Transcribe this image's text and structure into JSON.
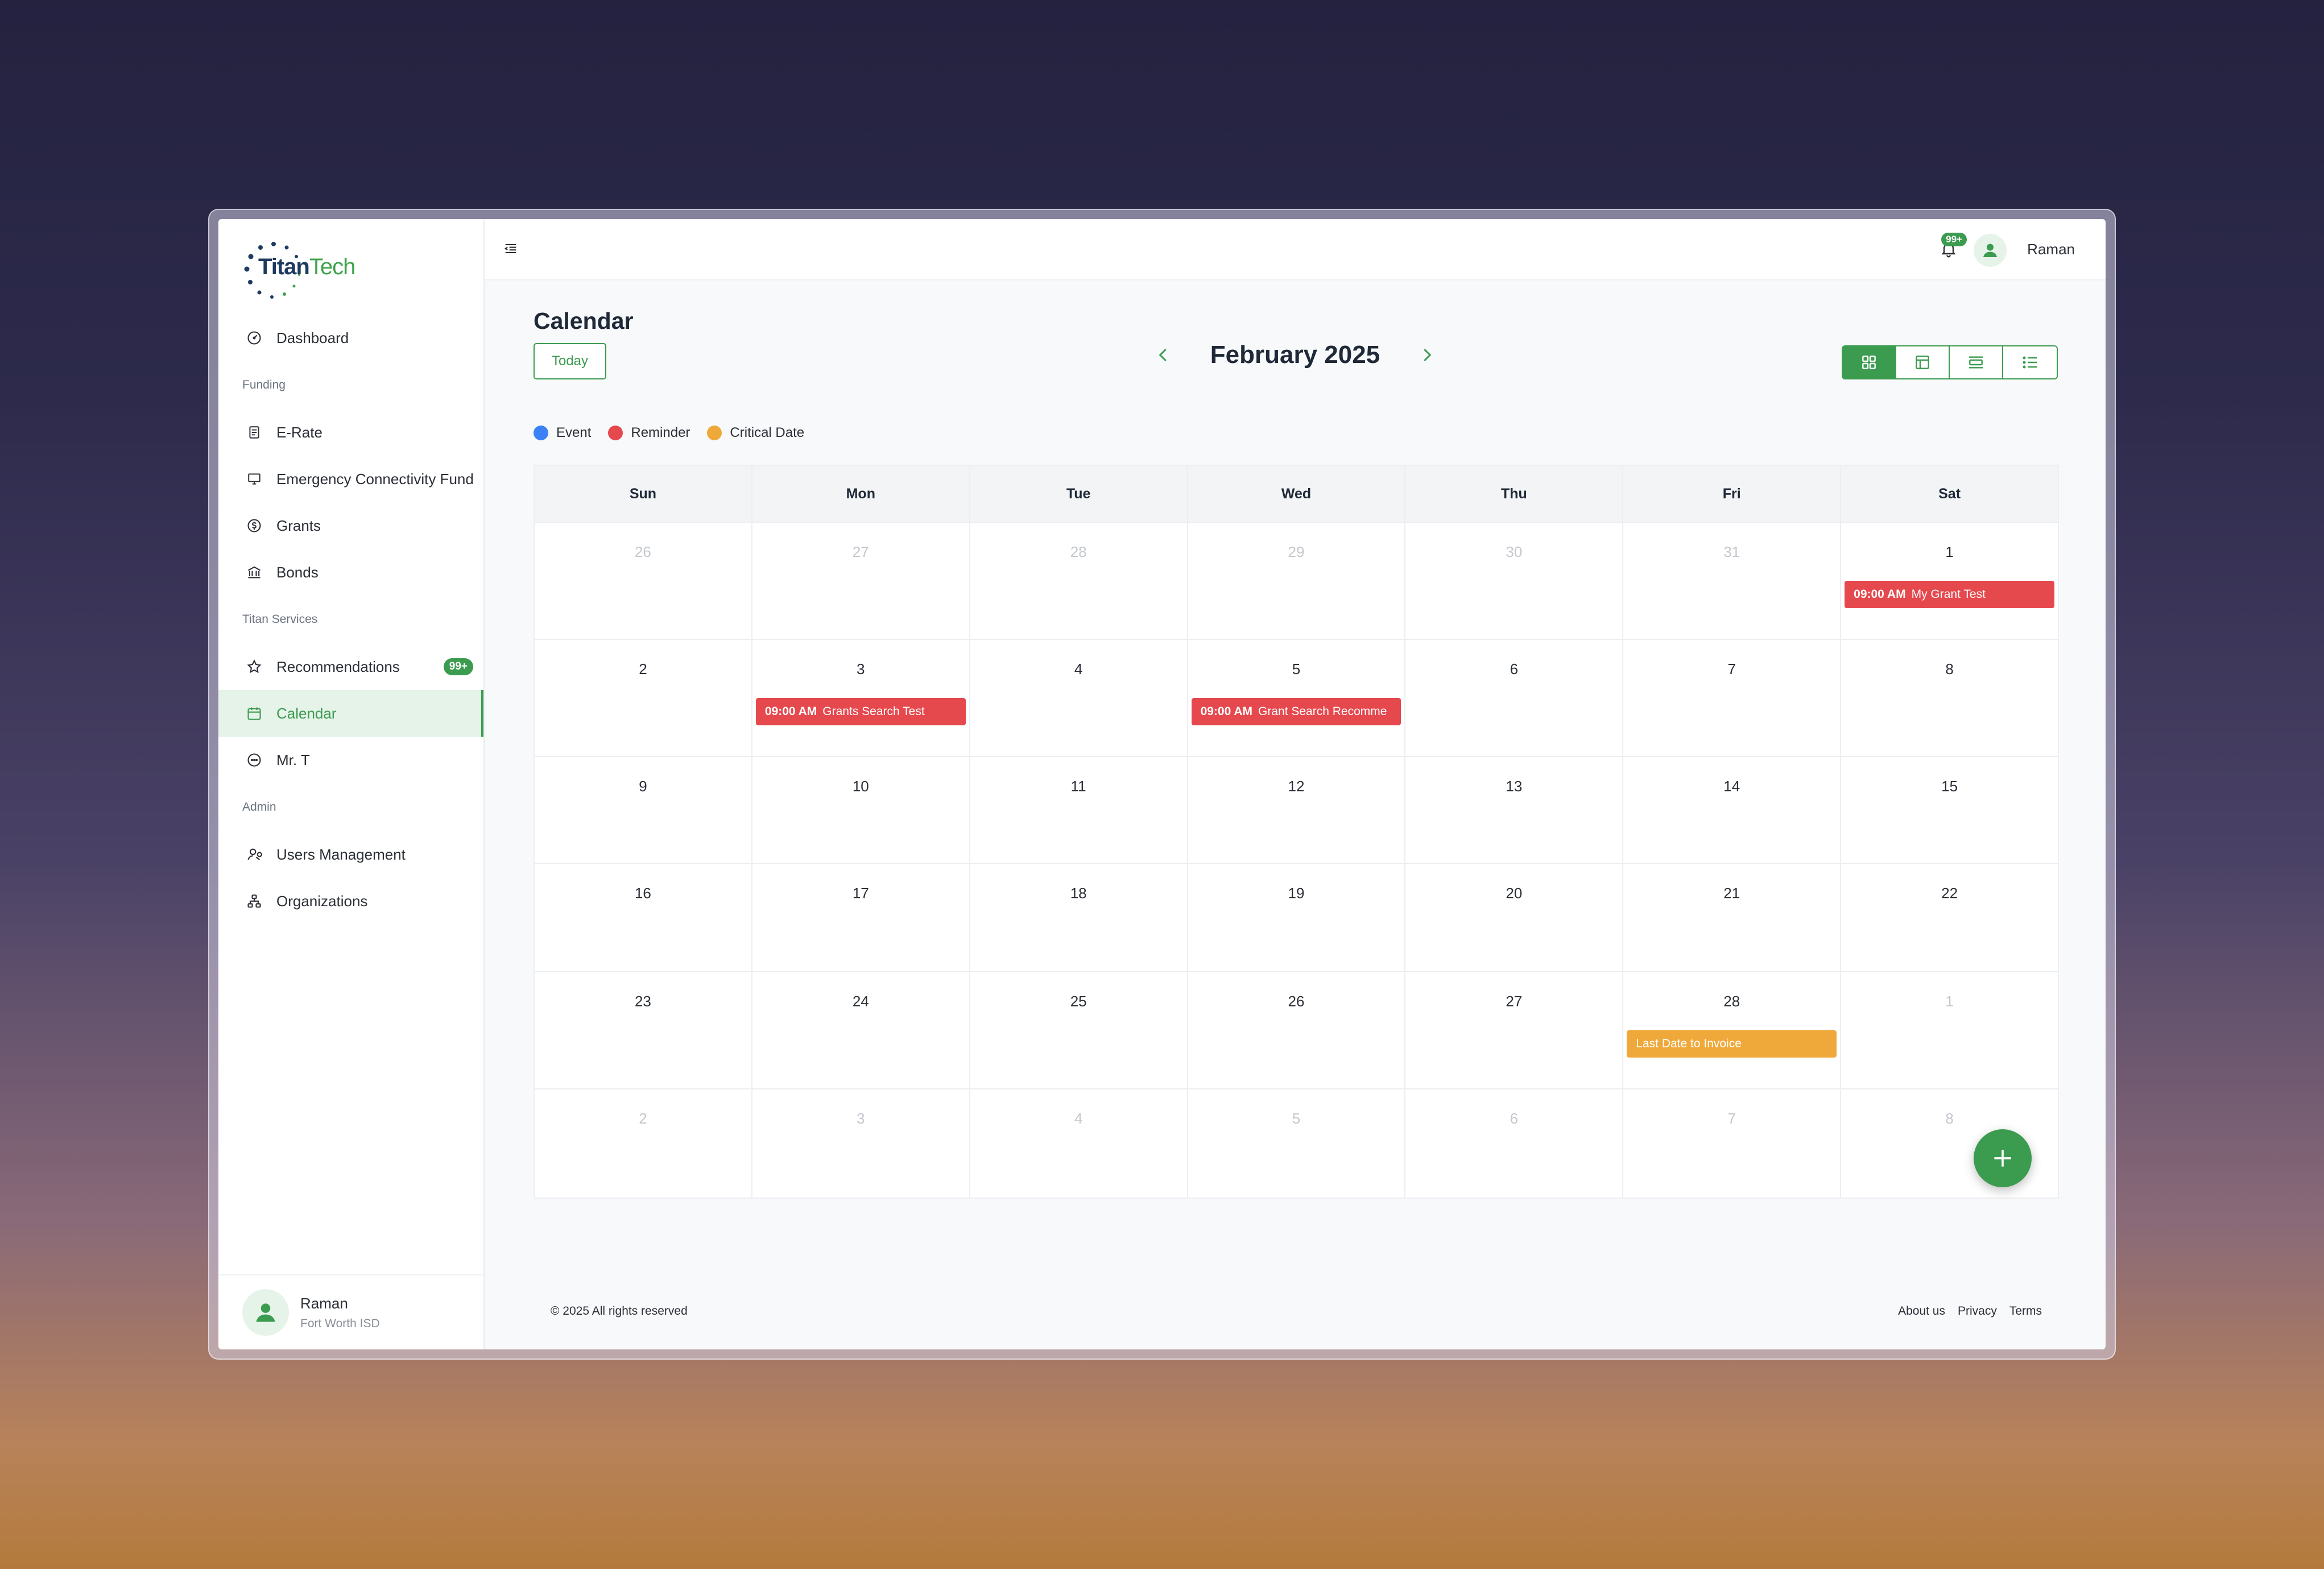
{
  "brand": {
    "name_part1": "Titan",
    "name_part2": "Tech"
  },
  "sidebar": {
    "items": [
      {
        "label": "Dashboard"
      },
      {
        "section": "Funding"
      },
      {
        "label": "E-Rate"
      },
      {
        "label": "Emergency Connectivity Fund"
      },
      {
        "label": "Grants"
      },
      {
        "label": "Bonds"
      },
      {
        "section": "Titan Services"
      },
      {
        "label": "Recommendations",
        "badge": "99+"
      },
      {
        "label": "Calendar"
      },
      {
        "label": "Mr. T"
      },
      {
        "section": "Admin"
      },
      {
        "label": "Users Management"
      },
      {
        "label": "Organizations"
      }
    ],
    "user": {
      "name": "Raman",
      "org": "Fort Worth ISD"
    }
  },
  "topbar": {
    "notifications_badge": "99+",
    "user_name": "Raman"
  },
  "page": {
    "title": "Calendar",
    "today_label": "Today",
    "month_title": "February 2025"
  },
  "legend": [
    {
      "label": "Event",
      "color": "#3b82f6"
    },
    {
      "label": "Reminder",
      "color": "#e5484d"
    },
    {
      "label": "Critical Date",
      "color": "#efa93a"
    }
  ],
  "colors": {
    "accent": "#3b9b4f",
    "reminder": "#e5484d",
    "critical": "#efa93a",
    "event": "#3b82f6"
  },
  "calendar": {
    "weekdays": [
      "Sun",
      "Mon",
      "Tue",
      "Wed",
      "Thu",
      "Fri",
      "Sat"
    ],
    "weeks": [
      [
        {
          "d": "26",
          "m": true
        },
        {
          "d": "27",
          "m": true
        },
        {
          "d": "28",
          "m": true
        },
        {
          "d": "29",
          "m": true
        },
        {
          "d": "30",
          "m": true
        },
        {
          "d": "31",
          "m": true
        },
        {
          "d": "1",
          "m": false,
          "ev": {
            "time": "09:00 AM",
            "title": "My Grant Test",
            "kind": "reminder"
          }
        }
      ],
      [
        {
          "d": "2",
          "m": false
        },
        {
          "d": "3",
          "m": false,
          "ev": {
            "time": "09:00 AM",
            "title": "Grants Search Test",
            "kind": "reminder"
          }
        },
        {
          "d": "4",
          "m": false
        },
        {
          "d": "5",
          "m": false,
          "ev": {
            "time": "09:00 AM",
            "title": "Grant Search Recomme",
            "kind": "reminder"
          }
        },
        {
          "d": "6",
          "m": false
        },
        {
          "d": "7",
          "m": false
        },
        {
          "d": "8",
          "m": false
        }
      ],
      [
        {
          "d": "9",
          "m": false
        },
        {
          "d": "10",
          "m": false
        },
        {
          "d": "11",
          "m": false
        },
        {
          "d": "12",
          "m": false
        },
        {
          "d": "13",
          "m": false
        },
        {
          "d": "14",
          "m": false
        },
        {
          "d": "15",
          "m": false
        }
      ],
      [
        {
          "d": "16",
          "m": false
        },
        {
          "d": "17",
          "m": false
        },
        {
          "d": "18",
          "m": false
        },
        {
          "d": "19",
          "m": false
        },
        {
          "d": "20",
          "m": false
        },
        {
          "d": "21",
          "m": false
        },
        {
          "d": "22",
          "m": false
        }
      ],
      [
        {
          "d": "23",
          "m": false
        },
        {
          "d": "24",
          "m": false
        },
        {
          "d": "25",
          "m": false
        },
        {
          "d": "26",
          "m": false
        },
        {
          "d": "27",
          "m": false
        },
        {
          "d": "28",
          "m": false,
          "ev": {
            "time": "",
            "title": "Last Date to Invoice",
            "kind": "critical"
          }
        },
        {
          "d": "1",
          "m": true
        }
      ],
      [
        {
          "d": "2",
          "m": true
        },
        {
          "d": "3",
          "m": true
        },
        {
          "d": "4",
          "m": true
        },
        {
          "d": "5",
          "m": true
        },
        {
          "d": "6",
          "m": true
        },
        {
          "d": "7",
          "m": true
        },
        {
          "d": "8",
          "m": true
        }
      ]
    ]
  },
  "footer": {
    "copyright": "© 2025 All rights reserved",
    "links": [
      "About us",
      "Privacy",
      "Terms"
    ]
  }
}
